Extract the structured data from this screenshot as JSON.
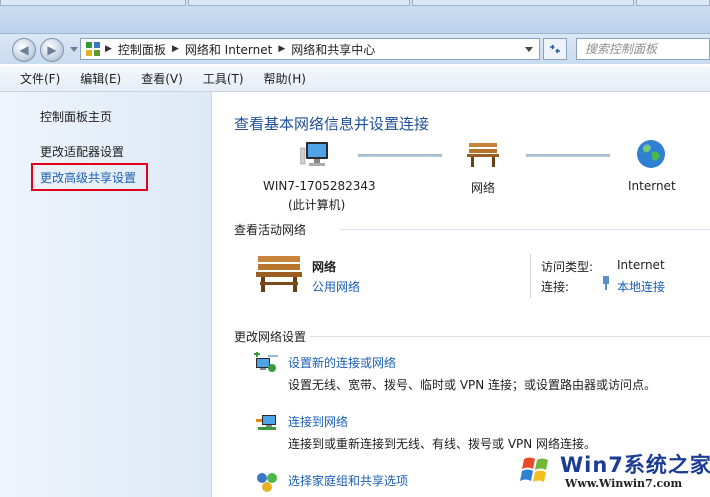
{
  "address_bar": {
    "crumbs": [
      "控制面板",
      "网络和 Internet",
      "网络和共享中心"
    ]
  },
  "search": {
    "placeholder": "搜索控制面板"
  },
  "menu": [
    "文件(F)",
    "编辑(E)",
    "查看(V)",
    "工具(T)",
    "帮助(H)"
  ],
  "sidebar": {
    "home": "控制面板主页",
    "items": [
      "更改适配器设置",
      "更改高级共享设置"
    ]
  },
  "main": {
    "title": "查看基本网络信息并设置连接",
    "map": {
      "computer_name": "WIN7-1705282343",
      "computer_sub": "(此计算机)",
      "network": "网络",
      "internet": "Internet"
    },
    "active_networks": {
      "heading": "查看活动网络",
      "name": "网络",
      "type": "公用网络",
      "access_label": "访问类型:",
      "access_value": "Internet",
      "conn_label": "连接:",
      "conn_value": "本地连接"
    },
    "change_settings": {
      "heading": "更改网络设置",
      "tasks": [
        {
          "link": "设置新的连接或网络",
          "desc": "设置无线、宽带、拨号、临时或 VPN 连接；或设置路由器或访问点。"
        },
        {
          "link": "连接到网络",
          "desc": "连接到或重新连接到无线、有线、拨号或 VPN 网络连接。"
        },
        {
          "link": "选择家庭组和共享选项",
          "desc": ""
        }
      ]
    }
  },
  "watermark": {
    "text": "Win7系统之家",
    "url": "Www.Winwin7.com"
  },
  "colors": {
    "link": "#1b5eb5",
    "highlight_box": "#e3001b",
    "title": "#1e4f9a"
  }
}
